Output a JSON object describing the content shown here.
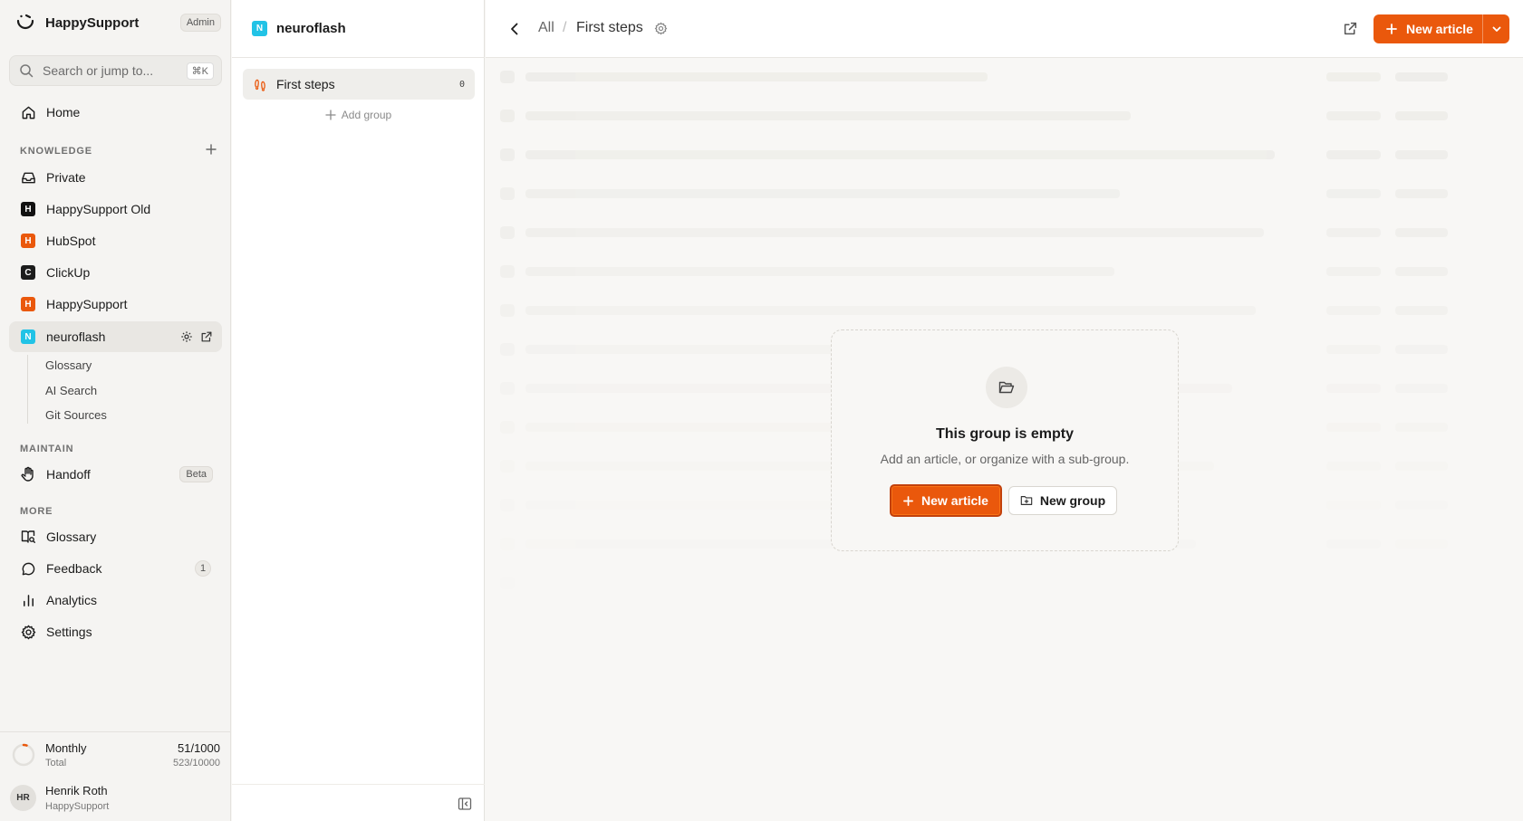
{
  "app": {
    "name": "HappySupport",
    "role_badge": "Admin"
  },
  "search": {
    "placeholder": "Search or jump to...",
    "shortcut": "⌘K"
  },
  "nav": {
    "home": "Home",
    "knowledge_label": "KNOWLEDGE",
    "knowledge_items": [
      {
        "label": "Private",
        "icon": "inbox-icon"
      },
      {
        "label": "HappySupport Old",
        "letter": "H",
        "color": "#111111"
      },
      {
        "label": "HubSpot",
        "letter": "H",
        "color": "#ea580c"
      },
      {
        "label": "ClickUp",
        "letter": "C",
        "color": "#1c1c1c"
      },
      {
        "label": "HappySupport",
        "letter": "H",
        "color": "#ea580c"
      },
      {
        "label": "neuroflash",
        "letter": "N",
        "color": "#22c3e6"
      }
    ],
    "sub_items": [
      "Glossary",
      "AI Search",
      "Git Sources"
    ],
    "maintain_label": "MAINTAIN",
    "handoff": "Handoff",
    "handoff_badge": "Beta",
    "more_label": "MORE",
    "glossary": "Glossary",
    "feedback": "Feedback",
    "feedback_count": "1",
    "analytics": "Analytics",
    "settings": "Settings"
  },
  "usage": {
    "title": "Monthly",
    "subtitle": "Total",
    "monthly": "51/1000",
    "total": "523/10000",
    "fraction": 0.051
  },
  "user": {
    "initials": "HR",
    "name": "Henrik Roth",
    "org": "HappySupport"
  },
  "groups_panel": {
    "space_letter": "N",
    "space_color": "#22c3e6",
    "title": "neuroflash",
    "groups": [
      {
        "label": "First steps",
        "count": "0"
      }
    ],
    "add_group": "Add group"
  },
  "header": {
    "crumb_all": "All",
    "crumb_sep": "/",
    "crumb_current": "First steps",
    "new_article": "New article"
  },
  "empty_state": {
    "title": "This group is empty",
    "subtitle": "Add an article, or organize with a sub-group.",
    "new_article": "New article",
    "new_group": "New group"
  },
  "colors": {
    "accent": "#ea580c",
    "neuroflash": "#22c3e6"
  }
}
